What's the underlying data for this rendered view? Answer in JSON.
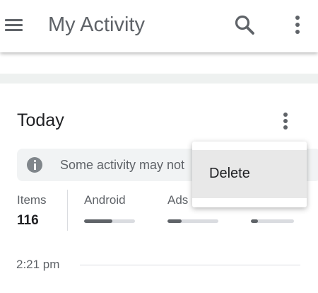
{
  "app_bar": {
    "title": "My Activity",
    "icons": [
      "menu-icon",
      "search-icon",
      "more-vert-icon"
    ]
  },
  "card": {
    "title": "Today",
    "more_icon": "more-vert-icon",
    "info_banner": {
      "icon": "info-icon",
      "text": "Some activity may not"
    },
    "stats": {
      "items_label": "Items",
      "items_value": "116",
      "android_label": "Android",
      "android_level": 0.55,
      "ads_label": "Ads",
      "ads_level": 0.28,
      "fourth_level": 0.16
    },
    "time": "2:21 pm"
  },
  "menu": {
    "delete_label": "Delete"
  },
  "colors": {
    "icon_gray": "#5f6368",
    "background": "#f1f3f4",
    "menu_highlight": "#e8e8e8"
  }
}
